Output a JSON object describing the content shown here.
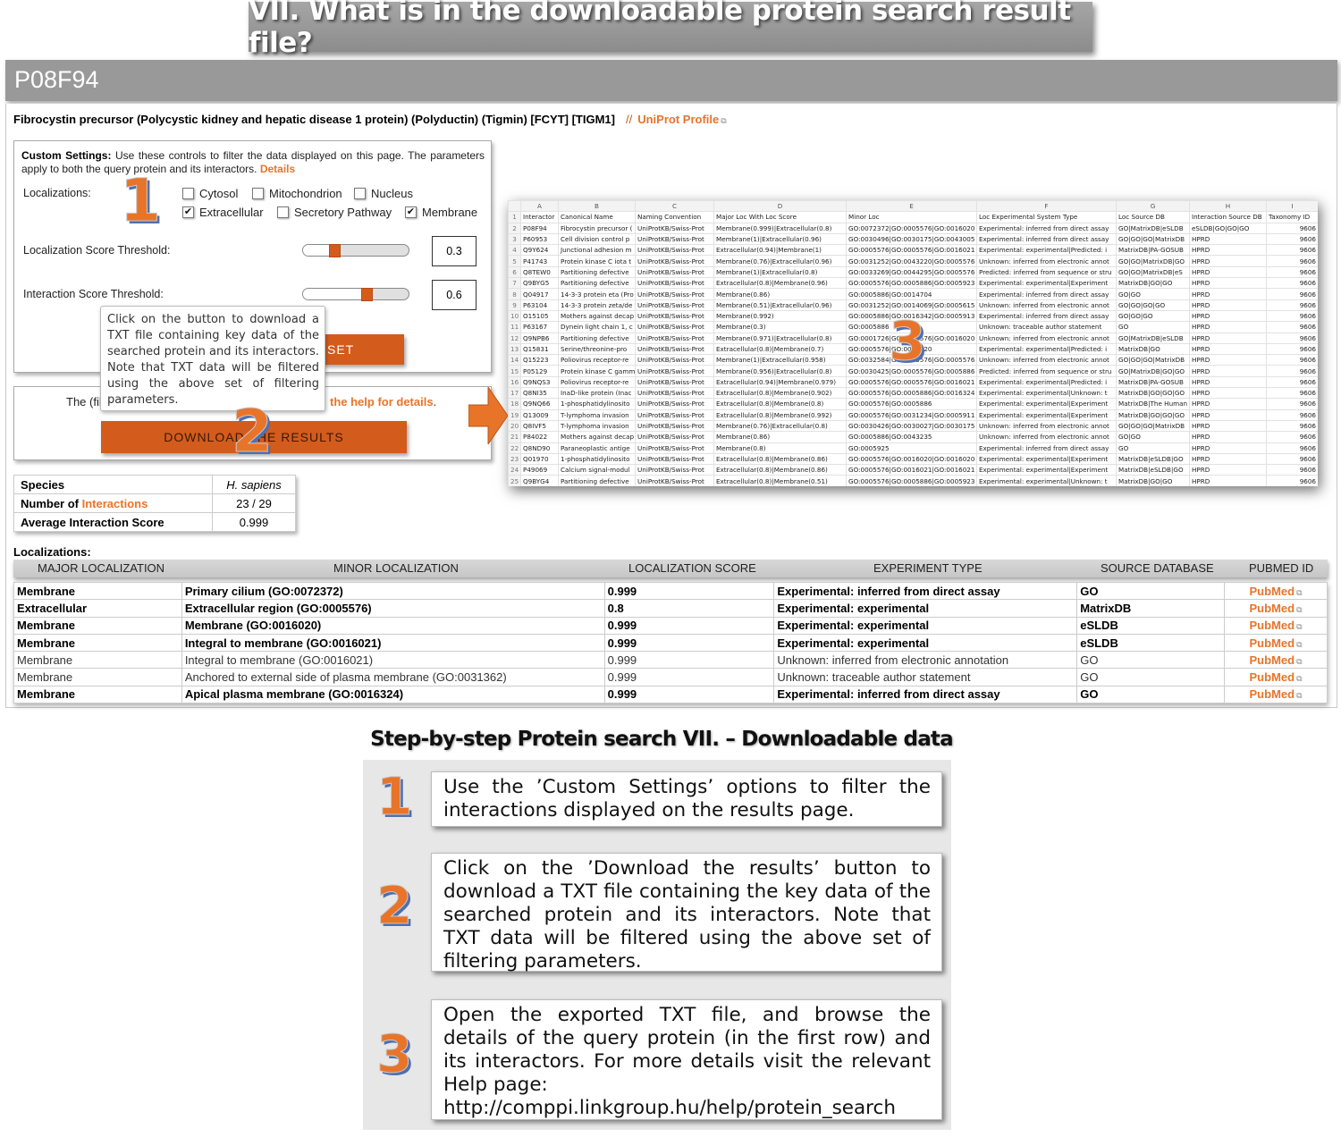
{
  "title": "VII. What is in the downloadable protein search result file?",
  "protein": {
    "id": "P08F94",
    "description": "Fibrocystin precursor (Polycystic kidney and hepatic disease 1 protein) (Polyductin) (Tigmin) [FCYT] [TIGM1]",
    "separator": "//",
    "uniprot_link": "UniProt Profile"
  },
  "custom_settings": {
    "intro_bold": "Custom Settings:",
    "intro_text": " Use these controls to filter the data displayed on this page. The parameters apply to both the query protein and its interactors. ",
    "details_link": "Details",
    "localizations_label": "Localizations:",
    "checkboxes": [
      {
        "label": "Cytosol",
        "checked": false
      },
      {
        "label": "Mitochondrion",
        "checked": false
      },
      {
        "label": "Nucleus",
        "checked": false
      },
      {
        "label": "Extracellular",
        "checked": true
      },
      {
        "label": "Secretory Pathway",
        "checked": false
      },
      {
        "label": "Membrane",
        "checked": true
      }
    ],
    "loc_threshold_label": "Localization Score Threshold:",
    "loc_threshold_value": "0.3",
    "loc_threshold_fraction": 0.3,
    "int_threshold_label": "Interaction Score Threshold:",
    "int_threshold_value": "0.6",
    "int_threshold_fraction": 0.6,
    "reset_label": "SET"
  },
  "tooltip": "Click on the button to download a TXT file containing key data of the searched protein and its interactors. Note that TXT data will be filtered using the above set of filtering parameters.",
  "download": {
    "text_prefix": "The (fil",
    "help_link": "the help for details",
    "help_suffix": ".",
    "button_label": "DOWNLOAD THE RESULTS"
  },
  "step_markers": [
    "1",
    "2",
    "3"
  ],
  "stats": {
    "rows": [
      {
        "label": "Species",
        "value": "H. sapiens"
      },
      {
        "label_prefix": "Number of ",
        "label_link": "Interactions",
        "value": "23 / 29"
      },
      {
        "label": "Average Interaction Score",
        "value": "0.999"
      }
    ]
  },
  "spreadsheet": {
    "columns": [
      "A",
      "B",
      "C",
      "D",
      "E",
      "F",
      "G",
      "H",
      "I"
    ],
    "header": [
      "Interactor",
      "Canonical Name",
      "Naming Convention",
      "Major Loc With Loc Score",
      "Minor Loc",
      "Loc Experimental System Type",
      "Loc Source DB",
      "Interaction Source DB",
      "Taxonomy ID"
    ],
    "rows": [
      [
        "P08F94",
        "Fibrocystin precursor (",
        "UniProtKB/Swiss-Prot",
        "Membrane(0.999)|Extracellular(0.8)",
        "GO:0072372|GO:0005576|GO:0016020",
        "Experimental: inferred from direct assay",
        "GO|MatrixDB|eSLDB",
        "eSLDB|GO|GO|GO",
        "9606"
      ],
      [
        "P60953",
        "Cell division control p",
        "UniProtKB/Swiss-Prot",
        "Membrane(1)|Extracellular(0.96)",
        "GO:0030496|GO:0030175|GO:0043005",
        "Experimental: inferred from direct assay",
        "GO|GO|GO|MatrixDB",
        "HPRD",
        "9606"
      ],
      [
        "Q9Y624",
        "Junctional adhesion m",
        "UniProtKB/Swiss-Prot",
        "Extracellular(0.94)|Membrane(1)",
        "GO:0005576|GO:0005576|GO:0016021",
        "Experimental: experimental|Predicted: i",
        "MatrixDB|PA-GOSUB",
        "HPRD",
        "9606"
      ],
      [
        "P41743",
        "Protein kinase C iota t",
        "UniProtKB/Swiss-Prot",
        "Membrane(0.76)|Extracellular(0.96)",
        "GO:0031252|GO:0043220|GO:0005576",
        "Unknown: inferred from electronic annot",
        "GO|GO|MatrixDB|GO",
        "HPRD",
        "9606"
      ],
      [
        "Q8TEW0",
        "Partitioning defective",
        "UniProtKB/Swiss-Prot",
        "Membrane(1)|Extracellular(0.8)",
        "GO:0033269|GO:0044295|GO:0005576",
        "Predicted: inferred from sequence or stru",
        "GO|GO|MatrixDB|eS",
        "HPRD",
        "9606"
      ],
      [
        "Q9BYG5",
        "Partitioning defective",
        "UniProtKB/Swiss-Prot",
        "Extracellular(0.8)|Membrane(0.96)",
        "GO:0005576|GO:0005886|GO:0005923",
        "Experimental: experimental|Experiment",
        "MatrixDB|GO|GO",
        "HPRD",
        "9606"
      ],
      [
        "Q04917",
        "14-3-3 protein eta (Pro",
        "UniProtKB/Swiss-Prot",
        "Membrane(0.86)",
        "GO:0005886|GO:0014704",
        "Experimental: inferred from direct assay",
        "GO|GO",
        "HPRD",
        "9606"
      ],
      [
        "P63104",
        "14-3-3 protein zeta/de",
        "UniProtKB/Swiss-Prot",
        "Membrane(0.51)|Extracellular(0.96)",
        "GO:0031252|GO:0014069|GO:0005615",
        "Unknown: inferred from electronic annot",
        "GO|GO|GO|GO",
        "HPRD",
        "9606"
      ],
      [
        "O15105",
        "Mothers against decap",
        "UniProtKB/Swiss-Prot",
        "Membrane(0.992)",
        "GO:0005886|GO:0016342|GO:0005913",
        "Experimental: inferred from direct assay",
        "GO|GO|GO",
        "HPRD",
        "9606"
      ],
      [
        "P63167",
        "Dynein light chain 1, c",
        "UniProtKB/Swiss-Prot",
        "Membrane(0.3)",
        "GO:0005886",
        "Unknown: traceable author statement",
        "GO",
        "HPRD",
        "9606"
      ],
      [
        "Q9NPB6",
        "Partitioning defective",
        "UniProtKB/Swiss-Prot",
        "Membrane(0.971)|Extracellular(0.8)",
        "GO:0001726|GO:0005576|GO:0016020",
        "Unknown: inferred from electronic annot",
        "GO|MatrixDB|eSLDB",
        "HPRD",
        "9606"
      ],
      [
        "Q15831",
        "Serine/threonine-pro",
        "UniProtKB/Swiss-Prot",
        "Extracellular(0.8)|Membrane(0.7)",
        "GO:0005576|GO:0016020",
        "Experimental: experimental|Predicted: i",
        "MatrixDB|GO",
        "HPRD",
        "9606"
      ],
      [
        "Q15223",
        "Poliovirus receptor-re",
        "UniProtKB/Swiss-Prot",
        "Membrane(1)|Extracellular(0.958)",
        "GO:0032584|GO:0005576|GO:0005576",
        "Unknown: inferred from electronic annot",
        "GO|GO|GO|MatrixDB",
        "HPRD",
        "9606"
      ],
      [
        "P05129",
        "Protein kinase C gamm",
        "UniProtKB/Swiss-Prot",
        "Membrane(0.956)|Extracellular(0.8)",
        "GO:0030425|GO:0005576|GO:0005886",
        "Predicted: inferred from sequence or stru",
        "GO|MatrixDB|GO|GO",
        "HPRD",
        "9606"
      ],
      [
        "Q9NQS3",
        "Poliovirus receptor-re",
        "UniProtKB/Swiss-Prot",
        "Extracellular(0.94)|Membrane(0.979)",
        "GO:0005576|GO:0005576|GO:0016021",
        "Experimental: experimental|Predicted: i",
        "MatrixDB|PA-GOSUB",
        "HPRD",
        "9606"
      ],
      [
        "Q8NI35",
        "InaD-like protein (Inac",
        "UniProtKB/Swiss-Prot",
        "Extracellular(0.8)|Membrane(0.902)",
        "GO:0005576|GO:0005886|GO:0016324",
        "Experimental: experimental|Unknown: t",
        "MatrixDB|GO|GO|GO",
        "HPRD",
        "9606"
      ],
      [
        "Q9NQ66",
        "1-phosphatidylinosito",
        "UniProtKB/Swiss-Prot",
        "Extracellular(0.8)|Membrane(0.8)",
        "GO:0005576|GO:0005886",
        "Experimental: experimental|Experiment",
        "MatrixDB|The Human",
        "HPRD",
        "9606"
      ],
      [
        "Q13009",
        "T-lymphoma invasion",
        "UniProtKB/Swiss-Prot",
        "Extracellular(0.8)|Membrane(0.992)",
        "GO:0005576|GO:0031234|GO:0005911",
        "Experimental: experimental|Experiment",
        "MatrixDB|GO|GO|GO",
        "HPRD",
        "9606"
      ],
      [
        "Q8IVF5",
        "T-lymphoma invasion",
        "UniProtKB/Swiss-Prot",
        "Membrane(0.76)|Extracellular(0.8)",
        "GO:0030426|GO:0030027|GO:0030175",
        "Unknown: inferred from electronic annot",
        "GO|GO|GO|MatrixDB",
        "HPRD",
        "9606"
      ],
      [
        "P84022",
        "Mothers against decap",
        "UniProtKB/Swiss-Prot",
        "Membrane(0.86)",
        "GO:0005886|GO:0043235",
        "Unknown: inferred from electronic annot",
        "GO|GO",
        "HPRD",
        "9606"
      ],
      [
        "Q8ND90",
        "Paraneoplastic antige",
        "UniProtKB/Swiss-Prot",
        "Membrane(0.8)",
        "GO:0005925",
        "Experimental: inferred from direct assay",
        "GO",
        "HPRD",
        "9606"
      ],
      [
        "Q01970",
        "1-phosphatidylinosito",
        "UniProtKB/Swiss-Prot",
        "Extracellular(0.8)|Membrane(0.86)",
        "GO:0005576|GO:0016020|GO:0016020",
        "Experimental: experimental|Experiment",
        "MatrixDB|eSLDB|GO",
        "HPRD",
        "9606"
      ],
      [
        "P49069",
        "Calcium signal-modul",
        "UniProtKB/Swiss-Prot",
        "Extracellular(0.8)|Membrane(0.86)",
        "GO:0005576|GO:0016021|GO:0016021",
        "Experimental: experimental|Experiment",
        "MatrixDB|eSLDB|GO",
        "HPRD",
        "9606"
      ],
      [
        "Q9BYG4",
        "Partitioning defective",
        "UniProtKB/Swiss-Prot",
        "Extracellular(0.8)|Membrane(0.51)",
        "GO:0005576|GO:0005886|GO:0005923",
        "Experimental: experimental|Unknown: t",
        "MatrixDB|GO|GO",
        "HPRD",
        "9606"
      ]
    ]
  },
  "localizations": {
    "title": "Localizations:",
    "headers": [
      "MAJOR LOCALIZATION",
      "MINOR LOCALIZATION",
      "LOCALIZATION SCORE",
      "EXPERIMENT TYPE",
      "SOURCE DATABASE",
      "PUBMED ID"
    ],
    "rows": [
      {
        "major": "Membrane",
        "minor": "Primary cilium (GO:0072372)",
        "score": "0.999",
        "experiment": "Experimental: inferred from direct assay",
        "source": "GO",
        "pubmed": "PubMed",
        "bold": true
      },
      {
        "major": "Extracellular",
        "minor": "Extracellular region (GO:0005576)",
        "score": "0.8",
        "experiment": "Experimental: experimental",
        "source": "MatrixDB",
        "pubmed": "PubMed",
        "bold": true
      },
      {
        "major": "Membrane",
        "minor": "Membrane (GO:0016020)",
        "score": "0.999",
        "experiment": "Experimental: experimental",
        "source": "eSLDB",
        "pubmed": "PubMed",
        "bold": true
      },
      {
        "major": "Membrane",
        "minor": "Integral to membrane (GO:0016021)",
        "score": "0.999",
        "experiment": "Experimental: experimental",
        "source": "eSLDB",
        "pubmed": "PubMed",
        "bold": true
      },
      {
        "major": "Membrane",
        "minor": "Integral to membrane (GO:0016021)",
        "score": "0.999",
        "experiment": "Unknown: inferred from electronic annotation",
        "source": "GO",
        "pubmed": "PubMed",
        "bold": false
      },
      {
        "major": "Membrane",
        "minor": "Anchored to external side of plasma membrane (GO:0031362)",
        "score": "0.999",
        "experiment": "Unknown: traceable author statement",
        "source": "GO",
        "pubmed": "PubMed",
        "bold": false
      },
      {
        "major": "Membrane",
        "minor": "Apical plasma membrane (GO:0016324)",
        "score": "0.999",
        "experiment": "Experimental: inferred from direct assay",
        "source": "GO",
        "pubmed": "PubMed",
        "bold": true
      }
    ]
  },
  "steps": {
    "title": "Step-by-step Protein search VII. – Downloadable data",
    "items": [
      {
        "number": "1",
        "text": "Use the ’Custom Settings’ options to filter the interactions displayed on the results page."
      },
      {
        "number": "2",
        "text": "Click on the ’Download the results’ button to download a TXT file containing the key data of the searched protein and its interactors. Note that TXT data will be filtered using the above set of filtering parameters."
      },
      {
        "number": "3",
        "text": "Open the exported TXT file, and browse the details of the query protein (in the first row) and its interactors. For more details visit the relevant Help page:",
        "url": "http://comppi.linkgroup.hu/help/protein_search"
      }
    ]
  },
  "colors": {
    "accent": "#e8742a",
    "button": "#d35b1c",
    "number_shadow": "#4f6fb0",
    "header_gray": "#999999"
  }
}
